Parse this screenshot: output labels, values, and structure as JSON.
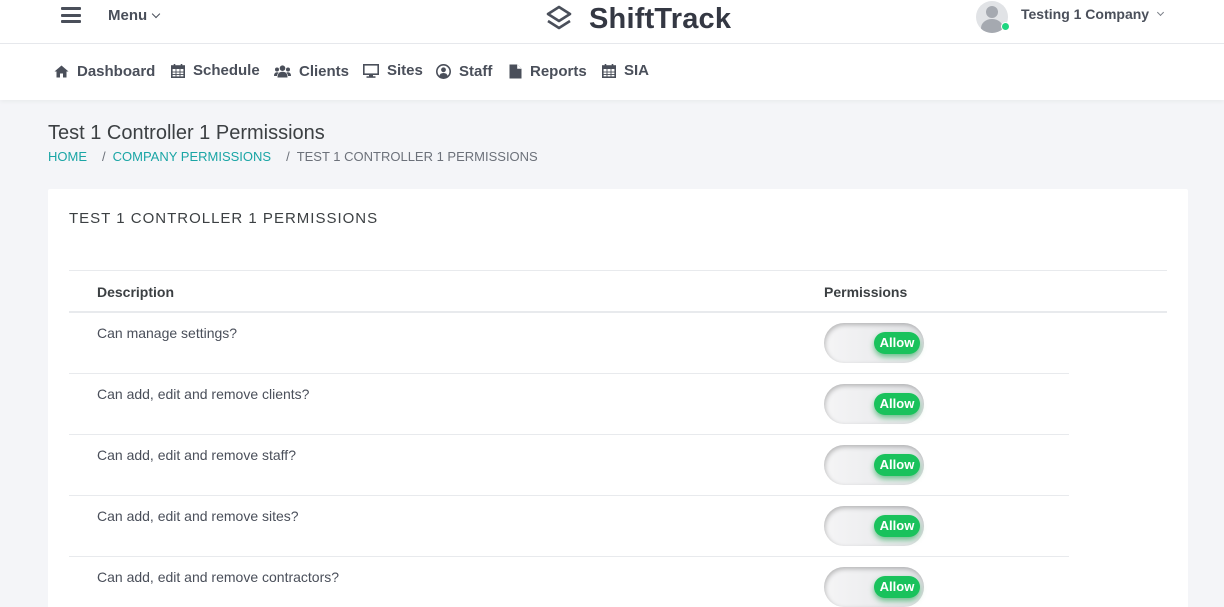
{
  "header": {
    "menu_label": "Menu",
    "brand_name": "ShiftTrack",
    "user_name": "Testing 1 Company"
  },
  "nav": {
    "items": [
      {
        "label": "Dashboard",
        "icon": "home-icon"
      },
      {
        "label": "Schedule",
        "icon": "calendar-icon"
      },
      {
        "label": "Clients",
        "icon": "users-icon"
      },
      {
        "label": "Sites",
        "icon": "monitor-icon"
      },
      {
        "label": "Staff",
        "icon": "user-circle-icon"
      },
      {
        "label": "Reports",
        "icon": "file-icon"
      },
      {
        "label": "SIA",
        "icon": "calendar-icon"
      }
    ]
  },
  "page": {
    "title": "Test 1 Controller 1 Permissions",
    "breadcrumb": {
      "home": "HOME",
      "separator": "/",
      "company_permissions": "COMPANY PERMISSIONS",
      "current": "TEST 1 CONTROLLER 1 PERMISSIONS"
    }
  },
  "card": {
    "title": "TEST 1 CONTROLLER 1 PERMISSIONS",
    "columns": {
      "description": "Description",
      "permissions": "Permissions"
    },
    "rows": [
      {
        "description": "Can manage settings?",
        "toggle_label": "Allow",
        "enabled": true
      },
      {
        "description": "Can add, edit and remove clients?",
        "toggle_label": "Allow",
        "enabled": true
      },
      {
        "description": "Can add, edit and remove staff?",
        "toggle_label": "Allow",
        "enabled": true
      },
      {
        "description": "Can add, edit and remove sites?",
        "toggle_label": "Allow",
        "enabled": true
      },
      {
        "description": "Can add, edit and remove contractors?",
        "toggle_label": "Allow",
        "enabled": true
      }
    ]
  },
  "colors": {
    "accent_teal": "#1aa5a5",
    "toggle_green": "#19c25c",
    "online_green": "#1ed680"
  }
}
